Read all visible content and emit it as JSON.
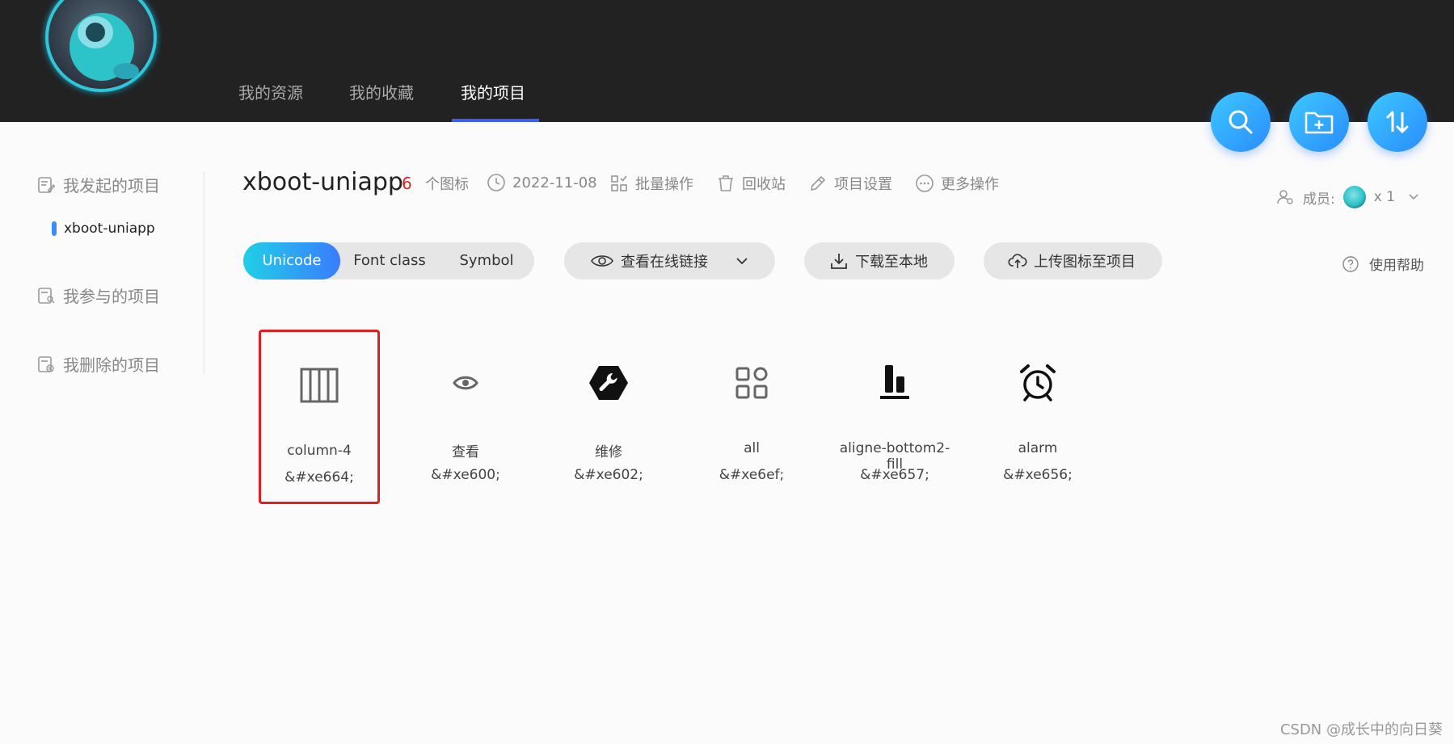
{
  "header": {
    "nav": [
      {
        "label": "我的资源"
      },
      {
        "label": "我的收藏"
      },
      {
        "label": "我的项目"
      }
    ],
    "fab": [
      "search-icon",
      "add-folder-icon",
      "sort-icon"
    ]
  },
  "sidebar": {
    "groups": [
      {
        "label": "我发起的项目",
        "icon": "project-started-icon"
      },
      {
        "label": "我参与的项目",
        "icon": "project-joined-icon"
      },
      {
        "label": "我删除的项目",
        "icon": "project-deleted-icon"
      }
    ],
    "active_project": "xboot-uniapp"
  },
  "project": {
    "title": "xboot-uniapp",
    "icon_count": "6",
    "icon_count_label": "个图标",
    "date": "2022-11-08",
    "actions": [
      {
        "label": "批量操作",
        "icon": "batch-icon"
      },
      {
        "label": "回收站",
        "icon": "trash-icon"
      },
      {
        "label": "项目设置",
        "icon": "edit-icon"
      },
      {
        "label": "更多操作",
        "icon": "more-icon"
      }
    ],
    "members_label": "成员:",
    "members_count": "x 1"
  },
  "toolbar": {
    "segments": [
      {
        "label": "Unicode",
        "active": true
      },
      {
        "label": "Font class",
        "active": false
      },
      {
        "label": "Symbol",
        "active": false
      }
    ],
    "view_link": "查看在线链接",
    "download": "下载至本地",
    "upload": "上传图标至项目",
    "help": "使用帮助"
  },
  "icons": [
    {
      "name": "column-4",
      "code": "&#xe664;",
      "icon": "column-4-icon",
      "selected": true
    },
    {
      "name": "查看",
      "code": "&#xe600;",
      "icon": "eye-icon",
      "selected": false
    },
    {
      "name": "维修",
      "code": "&#xe602;",
      "icon": "wrench-icon",
      "selected": false
    },
    {
      "name": "all",
      "code": "&#xe6ef;",
      "icon": "grid-all-icon",
      "selected": false
    },
    {
      "name": "aligne-bottom2-fill",
      "code": "&#xe657;",
      "icon": "align-bottom-icon",
      "selected": false
    },
    {
      "name": "alarm",
      "code": "&#xe656;",
      "icon": "alarm-icon",
      "selected": false
    }
  ],
  "watermark": "CSDN @成长中的向日葵",
  "colors": {
    "header_bg": "#222222",
    "accent_blue": "#3a7cff",
    "accent_cyan": "#20d0e6",
    "selected_border": "#e02020"
  }
}
